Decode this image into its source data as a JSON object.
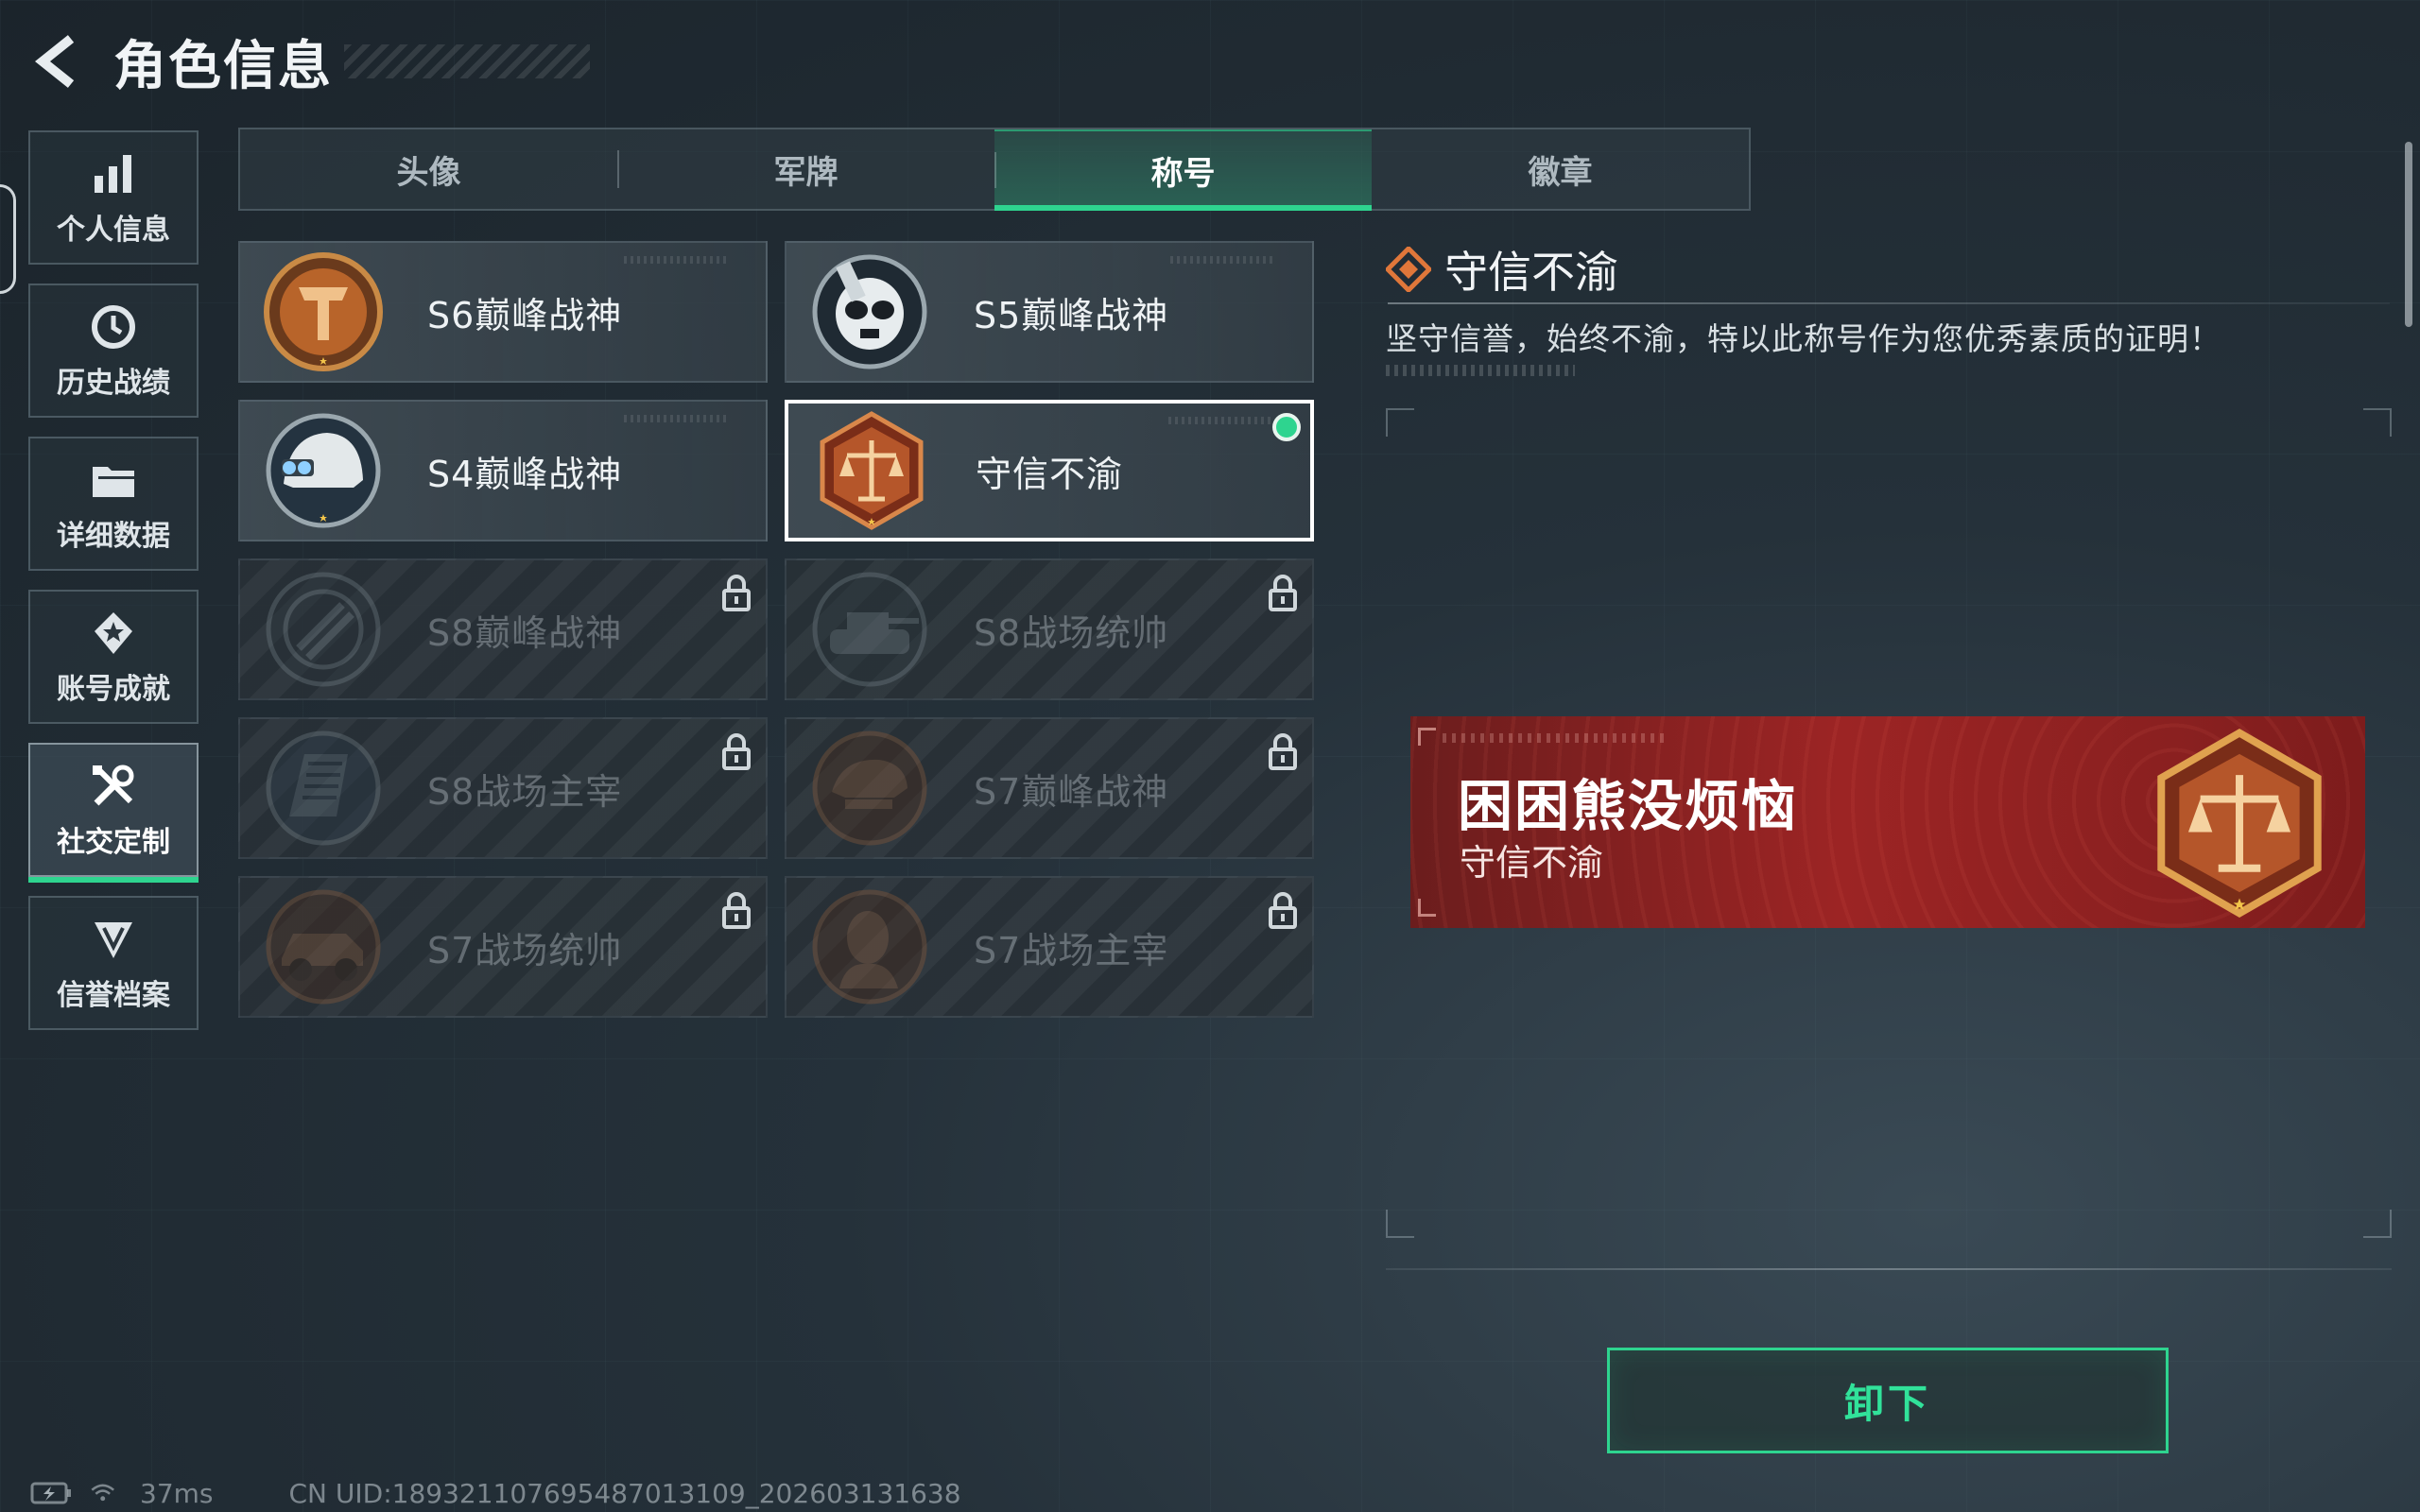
{
  "header": {
    "title": "角色信息"
  },
  "sidebar": {
    "items": [
      {
        "label": "个人信息",
        "icon": "bar-chart-icon",
        "active": false
      },
      {
        "label": "历史战绩",
        "icon": "clock-icon",
        "active": false
      },
      {
        "label": "详细数据",
        "icon": "folder-icon",
        "active": false
      },
      {
        "label": "账号成就",
        "icon": "achievement-icon",
        "active": false
      },
      {
        "label": "社交定制",
        "icon": "tools-icon",
        "active": true
      },
      {
        "label": "信誉档案",
        "icon": "shield-icon",
        "active": false
      }
    ]
  },
  "tabs": [
    {
      "label": "头像",
      "active": false
    },
    {
      "label": "军牌",
      "active": false
    },
    {
      "label": "称号",
      "active": true
    },
    {
      "label": "徽章",
      "active": false
    }
  ],
  "titles": [
    {
      "label": "S6巅峰战神",
      "medal": "medal-s6-icon",
      "locked": false,
      "selected": false
    },
    {
      "label": "S5巅峰战神",
      "medal": "medal-s5-icon",
      "locked": false,
      "selected": false
    },
    {
      "label": "S4巅峰战神",
      "medal": "medal-s4-icon",
      "locked": false,
      "selected": false
    },
    {
      "label": "守信不渝",
      "medal": "medal-scales-icon",
      "locked": false,
      "selected": true,
      "equipped": true
    },
    {
      "label": "S8巅峰战神",
      "medal": "medal-s8-icon",
      "locked": true,
      "selected": false
    },
    {
      "label": "S8战场统帅",
      "medal": "medal-tank-icon",
      "locked": true,
      "selected": false
    },
    {
      "label": "S8战场主宰",
      "medal": "medal-building-icon",
      "locked": true,
      "selected": false
    },
    {
      "label": "S7巅峰战神",
      "medal": "medal-helmet-icon",
      "locked": true,
      "selected": false
    },
    {
      "label": "S7战场统帅",
      "medal": "medal-vehicle-icon",
      "locked": true,
      "selected": false
    },
    {
      "label": "S7战场主宰",
      "medal": "medal-soldier-icon",
      "locked": true,
      "selected": false
    }
  ],
  "detail": {
    "name": "守信不渝",
    "description": "坚守信誉，始终不渝，特以此称号作为您优秀素质的证明！"
  },
  "banner": {
    "player_name": "困困熊没烦恼",
    "title": "守信不渝"
  },
  "action": {
    "unequip_label": "卸下"
  },
  "status": {
    "ping": "37ms",
    "uid": "CN UID:189321107695487013109_202603131638"
  },
  "colors": {
    "accent": "#2ed48f",
    "banner_red": "#9c2424",
    "medal_bronze": "#b8642a"
  }
}
